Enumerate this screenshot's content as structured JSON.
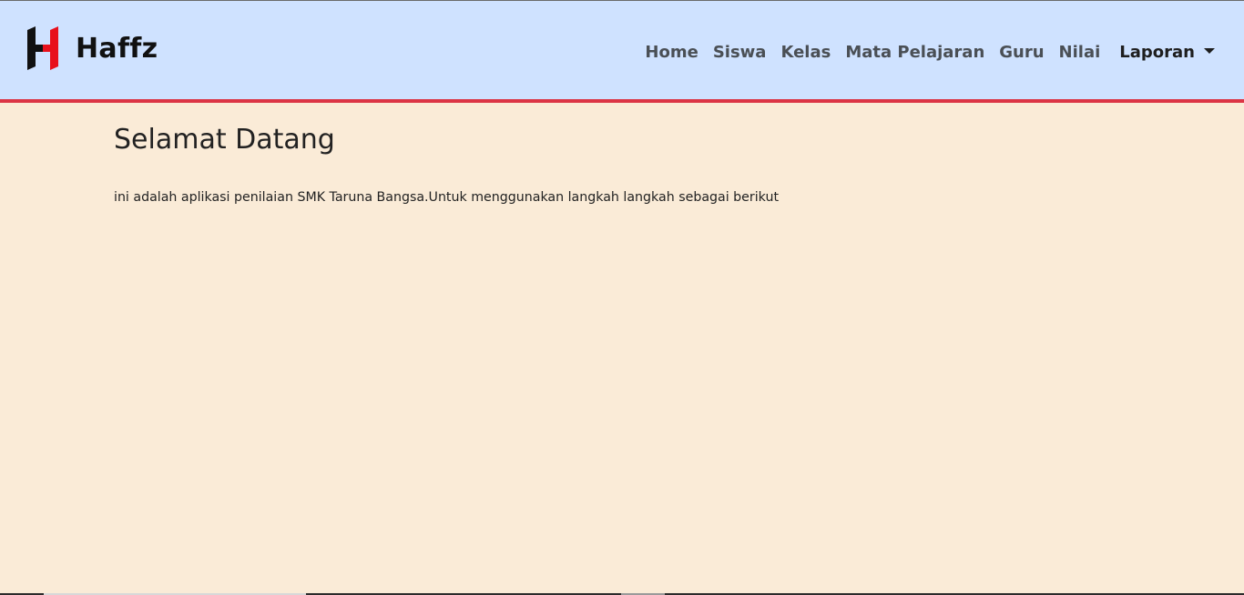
{
  "brand": {
    "name": "Haffz",
    "logo_colors": {
      "dark": "#111111",
      "accent": "#e8101b"
    }
  },
  "nav": {
    "items": [
      {
        "label": "Home"
      },
      {
        "label": "Siswa"
      },
      {
        "label": "Kelas"
      },
      {
        "label": "Mata Pelajaran"
      },
      {
        "label": "Guru"
      },
      {
        "label": "Nilai"
      }
    ],
    "dropdown": {
      "label": "Laporan",
      "icon": "caret-down-icon"
    }
  },
  "main": {
    "title": "Selamat Datang",
    "intro": "ini adalah aplikasi penilaian SMK Taruna Bangsa.Untuk menggunakan langkah langkah sebagai berikut"
  },
  "colors": {
    "navbar_bg": "#cfe2ff",
    "navbar_border": "#dc3545",
    "page_bg": "#faebd7"
  }
}
